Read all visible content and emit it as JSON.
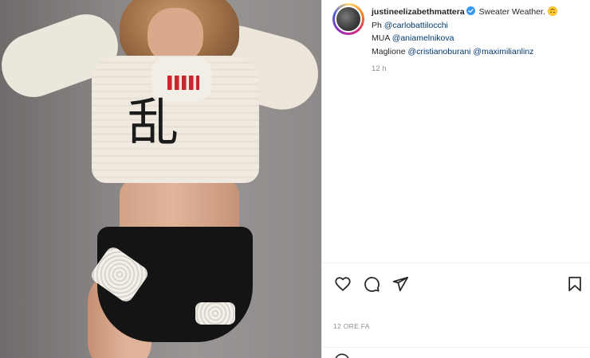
{
  "post": {
    "username": "justineelizabethmattera",
    "caption_text": "Sweater Weather.",
    "caption_emoji": "upside-down-face-emoji",
    "credits": [
      {
        "label": "Ph",
        "mentions": [
          "@carlobattilocchi"
        ]
      },
      {
        "label": "MUA",
        "mentions": [
          "@aniamelnikova"
        ]
      },
      {
        "label": "Maglione",
        "mentions": [
          "@cristianoburani",
          "@maximilianlinz"
        ]
      }
    ],
    "time_ago": "12 h",
    "timestamp": "12 ORE FA"
  },
  "media": {
    "alt": "",
    "icon": "photo"
  },
  "actions": {
    "like_icon": "heart-icon",
    "comment_icon": "comment-icon",
    "share_icon": "paper-plane-icon",
    "save_icon": "bookmark-icon"
  },
  "colors": {
    "text": "#262626",
    "mention": "#00376b",
    "secondary": "#8e8e8e",
    "verified": "#3897f0",
    "divider": "#efefef"
  }
}
